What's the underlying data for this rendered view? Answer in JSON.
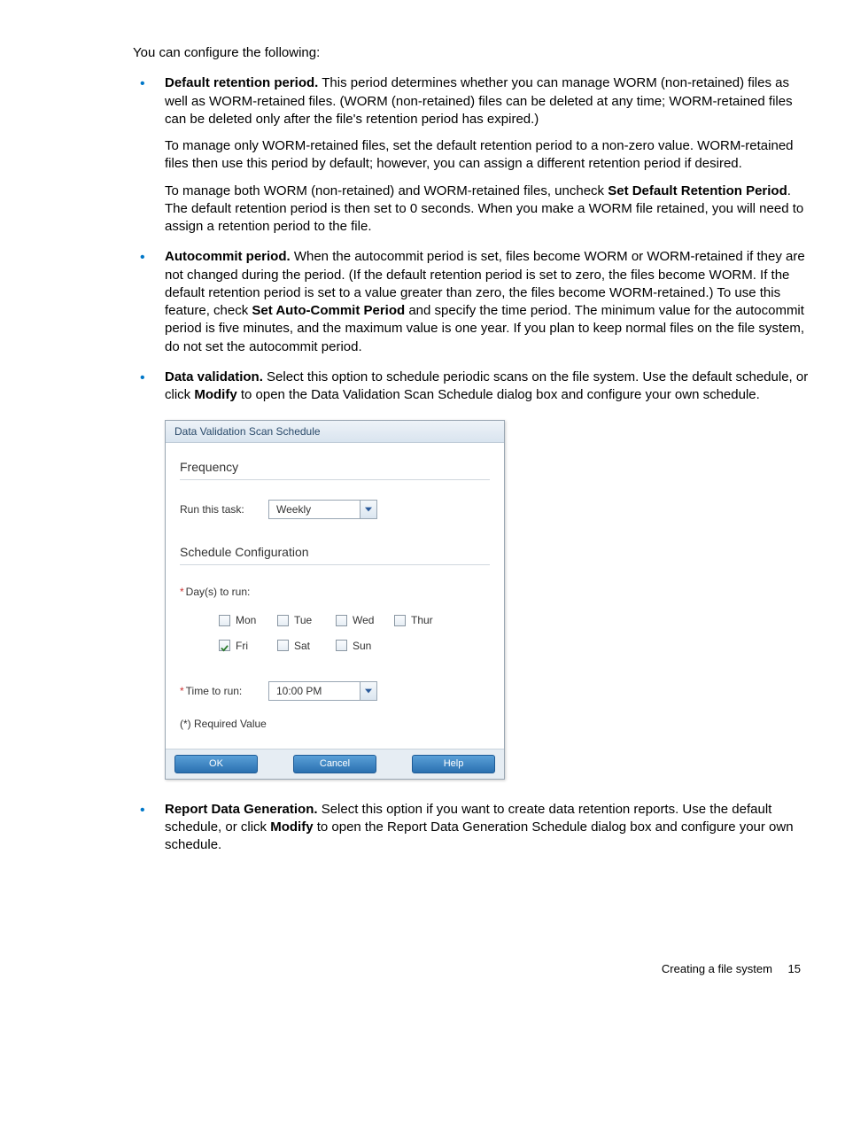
{
  "intro": "You can configure the following:",
  "bullets": {
    "b1": {
      "title": "Default retention period.",
      "p1": "This period determines whether you can manage WORM (non-retained) files as well as WORM-retained files. (WORM (non-retained) files can be deleted at any time; WORM-retained files can be deleted only after the file's retention period has expired.)",
      "p2": "To manage only WORM-retained files, set the default retention period to a non-zero value. WORM-retained files then use this period by default; however, you can assign a different retention period if desired.",
      "p3a": "To manage both WORM (non-retained) and WORM-retained files, uncheck ",
      "p3bold": "Set Default Retention Period",
      "p3b": ". The default retention period is then set to 0 seconds. When you make a WORM file retained, you will need to assign a retention period to the file."
    },
    "b2": {
      "title": "Autocommit period.",
      "p1a": "When the autocommit period is set, files become WORM or WORM-retained if they are not changed during the period. (If the default retention period is set to zero, the files become WORM. If the default retention period is set to a value greater than zero, the files become WORM-retained.) To use this feature, check ",
      "p1bold": "Set Auto-Commit Period",
      "p1b": " and specify the time period. The minimum value for the autocommit period is five minutes, and the maximum value is one year. If you plan to keep normal files on the file system, do not set the autocommit period."
    },
    "b3": {
      "title": "Data validation.",
      "p1a": "Select this option to schedule periodic scans on the file system. Use the default schedule, or click ",
      "p1bold": "Modify",
      "p1b": " to open the Data Validation Scan Schedule dialog box and configure your own schedule."
    },
    "b4": {
      "title": "Report Data Generation.",
      "p1a": "Select this option if you want to create data retention reports. Use the default schedule, or click ",
      "p1bold": "Modify",
      "p1b": " to open the Report Data Generation Schedule dialog box and configure your own schedule."
    }
  },
  "dialog": {
    "title": "Data Validation Scan Schedule",
    "frequency_h": "Frequency",
    "run_label": "Run this task:",
    "run_value": "Weekly",
    "sched_h": "Schedule Configuration",
    "days_label": "Day(s) to run:",
    "days": {
      "mon": "Mon",
      "tue": "Tue",
      "wed": "Wed",
      "thur": "Thur",
      "fri": "Fri",
      "sat": "Sat",
      "sun": "Sun"
    },
    "time_label": "Time to run:",
    "time_value": "10:00 PM",
    "req_note": "(*) Required Value",
    "ok": "OK",
    "cancel": "Cancel",
    "help": "Help"
  },
  "footer": {
    "text": "Creating a file system",
    "page": "15"
  }
}
